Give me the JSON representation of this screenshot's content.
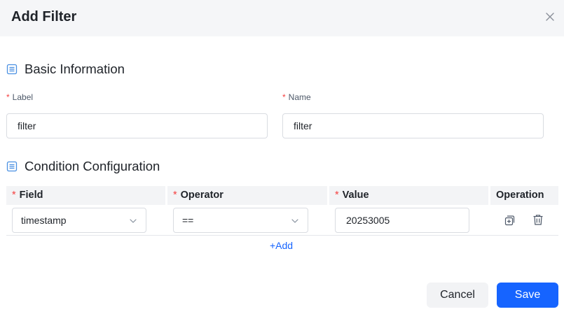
{
  "dialog": {
    "title": "Add Filter"
  },
  "basic_info": {
    "heading": "Basic Information",
    "label_field": {
      "label": "Label",
      "required_mark": "*",
      "value": "filter"
    },
    "name_field": {
      "label": "Name",
      "required_mark": "*",
      "value": "filter"
    }
  },
  "condition": {
    "heading": "Condition Configuration",
    "columns": {
      "field": "Field",
      "operator": "Operator",
      "value": "Value",
      "operation": "Operation",
      "required_mark": "*"
    },
    "rows": [
      {
        "field": "timestamp",
        "operator": "==",
        "value": "20253005"
      }
    ],
    "add_label": "+Add"
  },
  "footer": {
    "cancel_label": "Cancel",
    "save_label": "Save"
  },
  "colors": {
    "accent": "#1664ff",
    "required": "#f53f3f",
    "header_bg": "#f5f6f8",
    "section_icon": "#4a90e2"
  },
  "icons": {
    "close": "close-icon",
    "section": "list-doc-icon",
    "copy": "copy-add-icon",
    "delete": "trash-icon",
    "chevron": "chevron-down-icon"
  }
}
